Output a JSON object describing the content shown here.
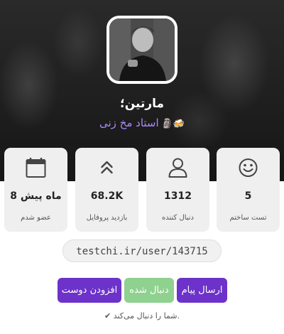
{
  "profile": {
    "name": "مارتین؛",
    "tagline": "استاد مخ زنی",
    "tagline_emojis": "🗿🍻"
  },
  "stats": [
    {
      "icon": "smiley-icon",
      "value": "5",
      "label": "تست ساختم"
    },
    {
      "icon": "user-icon",
      "value": "1312",
      "label": "دنبال کننده"
    },
    {
      "icon": "double-chevron-up-icon",
      "value": "68.2K",
      "label": "بازدید پروفایل"
    },
    {
      "icon": "calendar-icon",
      "value": "8 ماه پیش",
      "label": "عضو شدم"
    }
  ],
  "profile_link": "testchi.ir/user/143715",
  "actions": {
    "send_message": "ارسال پیام",
    "following": "دنبال شده",
    "add_friend": "افزودن دوست"
  },
  "follow_note": "✔ شما را دنبال می‌کند.",
  "colors": {
    "accent": "#6d32c9",
    "following": "#8fd18f",
    "tagline": "#a78bfa"
  }
}
